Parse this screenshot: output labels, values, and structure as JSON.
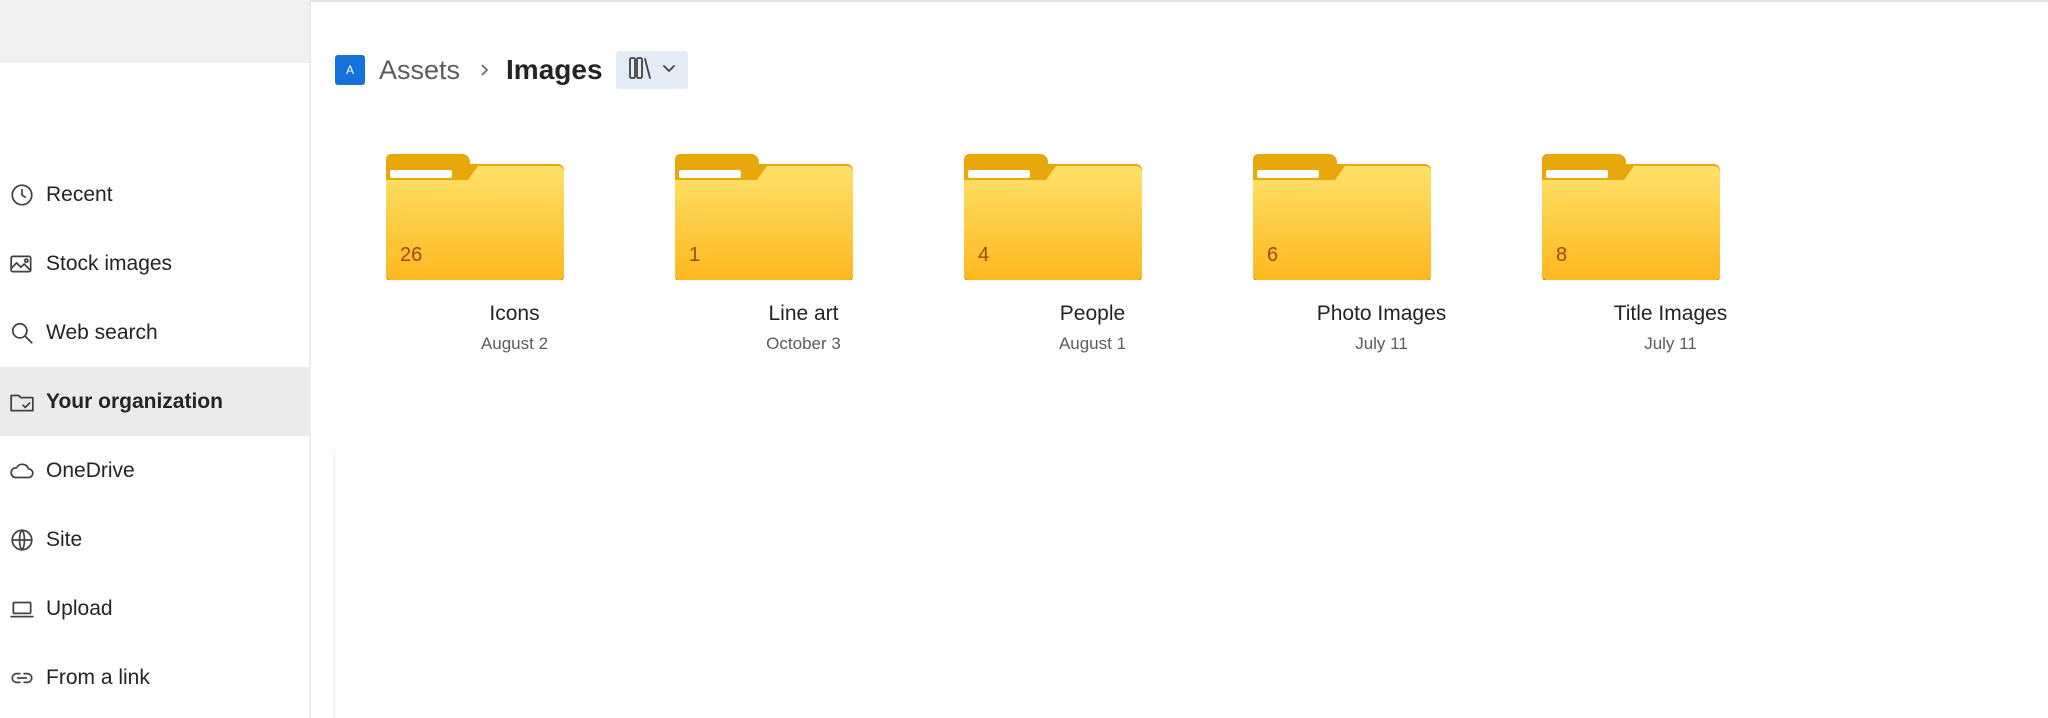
{
  "sidebar": {
    "items": [
      {
        "label": "Recent",
        "icon": "clock-icon",
        "active": false
      },
      {
        "label": "Stock images",
        "icon": "stock-images-icon",
        "active": false
      },
      {
        "label": "Web search",
        "icon": "search-icon",
        "active": false
      },
      {
        "label": "Your organization",
        "icon": "organization-folder-icon",
        "active": true
      },
      {
        "label": "OneDrive",
        "icon": "cloud-icon",
        "active": false
      },
      {
        "label": "Site",
        "icon": "globe-icon",
        "active": false
      },
      {
        "label": "Upload",
        "icon": "laptop-icon",
        "active": false
      },
      {
        "label": "From a link",
        "icon": "link-icon",
        "active": false
      }
    ]
  },
  "breadcrumb": {
    "badge": "A",
    "parent": "Assets",
    "current": "Images",
    "view_icon": "library-view-icon"
  },
  "folders": [
    {
      "name": "Icons",
      "date": "August 2",
      "count": "26"
    },
    {
      "name": "Line art",
      "date": "October 3",
      "count": "1"
    },
    {
      "name": "People",
      "date": "August 1",
      "count": "4"
    },
    {
      "name": "Photo Images",
      "date": "July 11",
      "count": "6"
    },
    {
      "name": "Title Images",
      "date": "July 11",
      "count": "8"
    }
  ],
  "colors": {
    "accent": "#1472d9",
    "folder": "#ffc83d",
    "active_bg": "#ebebeb"
  }
}
